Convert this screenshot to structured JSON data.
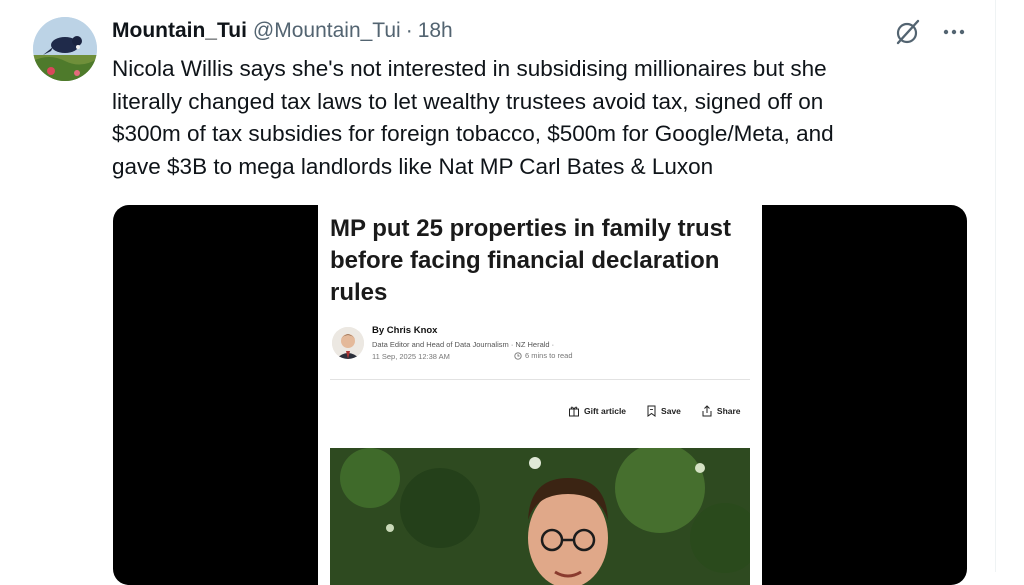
{
  "tweet": {
    "display_name": "Mountain_Tui",
    "handle": "@Mountain_Tui",
    "separator": "·",
    "time": "18h",
    "text_lines": [
      "Nicola Willis says she's not interested in subsidising millionaires but she",
      "literally changed tax laws to let wealthy trustees avoid tax, signed off on",
      "$300m of tax subsidies for foreign tobacco, $500m for Google/Meta, and",
      "gave $3B to mega landlords like Nat MP Carl Bates & Luxon"
    ]
  },
  "article": {
    "headline_lines": [
      "MP put 25 properties in family trust",
      "before facing financial declaration",
      "rules"
    ],
    "byline": "By Chris Knox",
    "role": "Data Editor and Head of Data Journalism · NZ Herald ·",
    "date": "11 Sep, 2025 12:38 AM",
    "read_time": "6 mins to read",
    "actions": {
      "gift": "Gift article",
      "save": "Save",
      "share": "Share"
    }
  },
  "icons": {
    "grok": "grok-icon",
    "more": "more-icon"
  },
  "colors": {
    "text": "#0f1419",
    "secondary": "#536471",
    "media_bg": "#000000"
  }
}
